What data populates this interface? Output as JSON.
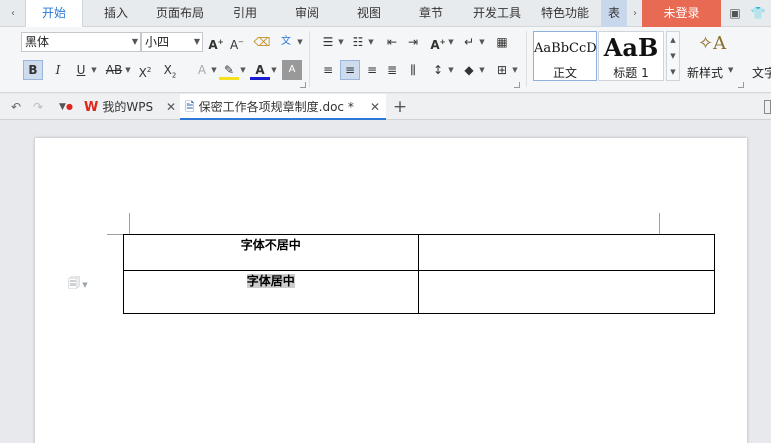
{
  "menu": {
    "tabs": [
      {
        "label": "开始",
        "active": true
      },
      {
        "label": "插入"
      },
      {
        "label": "页面布局"
      },
      {
        "label": "引用"
      },
      {
        "label": "审阅"
      },
      {
        "label": "视图"
      },
      {
        "label": "章节"
      },
      {
        "label": "开发工具"
      },
      {
        "label": "特色功能"
      },
      {
        "label": "表"
      }
    ],
    "login": "未登录"
  },
  "ribbon": {
    "font_name": "黑体",
    "font_size": "小四",
    "styles": [
      {
        "preview": "AaBbCcD",
        "label": "正文"
      },
      {
        "preview": "AaB",
        "label": "标题 1"
      }
    ],
    "new_style": "新样式",
    "text_tool": "文字"
  },
  "doc_tabs": {
    "home": "我的WPS",
    "current": "保密工作各项规章制度.doc *"
  },
  "document": {
    "row1": "字体不居中",
    "row2": "字体居中"
  },
  "colors": {
    "accent": "#2a78d7",
    "login_bg": "#e86a52",
    "wps_red": "#e0251b"
  }
}
